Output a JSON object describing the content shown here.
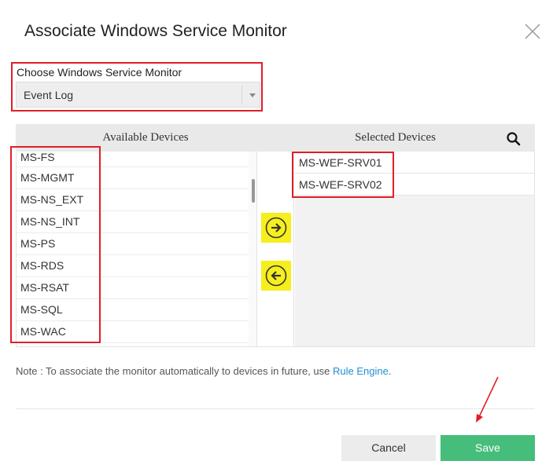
{
  "dialog": {
    "title": "Associate Windows Service Monitor"
  },
  "monitor": {
    "label": "Choose Windows Service Monitor",
    "selected": "Event Log"
  },
  "available": {
    "header": "Available Devices",
    "items": [
      "MS-FS",
      "MS-MGMT",
      "MS-NS_EXT",
      "MS-NS_INT",
      "MS-PS",
      "MS-RDS",
      "MS-RSAT",
      "MS-SQL",
      "MS-WAC"
    ]
  },
  "selected": {
    "header": "Selected Devices",
    "items": [
      "MS-WEF-SRV01",
      "MS-WEF-SRV02"
    ]
  },
  "note": {
    "text": "Note : To associate the monitor automatically to devices in future, use ",
    "link": "Rule Engine",
    "suffix": "."
  },
  "buttons": {
    "cancel": "Cancel",
    "save": "Save"
  },
  "icons": {
    "close": "close-icon",
    "search": "search-icon",
    "move_right": "arrow-right-circle-icon",
    "move_left": "arrow-left-circle-icon",
    "select_caret": "caret-down-icon"
  },
  "colors": {
    "save_button": "#47bd7b",
    "link": "#1e90d6",
    "highlight": "#f6ef1c",
    "annotation": "#e01f26"
  }
}
